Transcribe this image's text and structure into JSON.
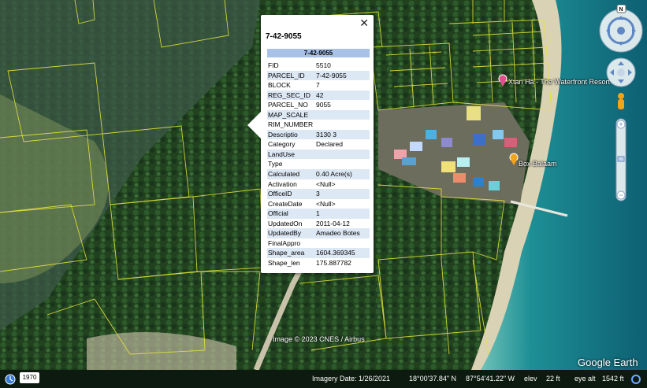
{
  "map": {
    "places": [
      "Xtan Ha - The Waterfront Resort",
      "Box Balaam"
    ],
    "attribution": "Image © 2023 CNES / Airbus",
    "logo": "Google Earth",
    "colors": {
      "parcel_line": "#e6e23a",
      "pin_pink": "#e0508a",
      "pin_orange": "#f2a31c"
    }
  },
  "popup": {
    "title": "7-42-9055",
    "header": "7-42-9055",
    "close_label": "✕",
    "rows": [
      [
        "FID",
        "5510"
      ],
      [
        "PARCEL_ID",
        "7-42-9055"
      ],
      [
        "BLOCK",
        "7"
      ],
      [
        "REG_SEC_ID",
        "42"
      ],
      [
        "PARCEL_NO",
        "9055"
      ],
      [
        "MAP_SCALE",
        ""
      ],
      [
        "RIM_NUMBER",
        ""
      ],
      [
        "Descriptio",
        "3130 3"
      ],
      [
        "Category",
        "Declared"
      ],
      [
        "LandUse",
        ""
      ],
      [
        "Type",
        ""
      ],
      [
        "Calculated",
        "0.40 Acre(s)"
      ],
      [
        "Activation",
        "<Null>"
      ],
      [
        "OfficeID",
        "3"
      ],
      [
        "CreateDate",
        "<Null>"
      ],
      [
        "Official",
        "1"
      ],
      [
        "UpdatedOn",
        "2011-04-12"
      ],
      [
        "UpdatedBy",
        "Amadeo Botes"
      ],
      [
        "FinalAppro",
        ""
      ],
      [
        "Shape_area",
        "1604.369345"
      ],
      [
        "Shape_len",
        "175.887782"
      ]
    ]
  },
  "nav": {
    "north_label": "N"
  },
  "status": {
    "history_year": "1970",
    "imagery_date": "Imagery Date: 1/26/2021",
    "lat": "18°00'37.84\" N",
    "lon": "87°54'41.22\" W",
    "elev_label": "elev",
    "elev_value": "22 ft",
    "eye_alt_label": "eye alt",
    "eye_alt_value": "1542 ft"
  }
}
